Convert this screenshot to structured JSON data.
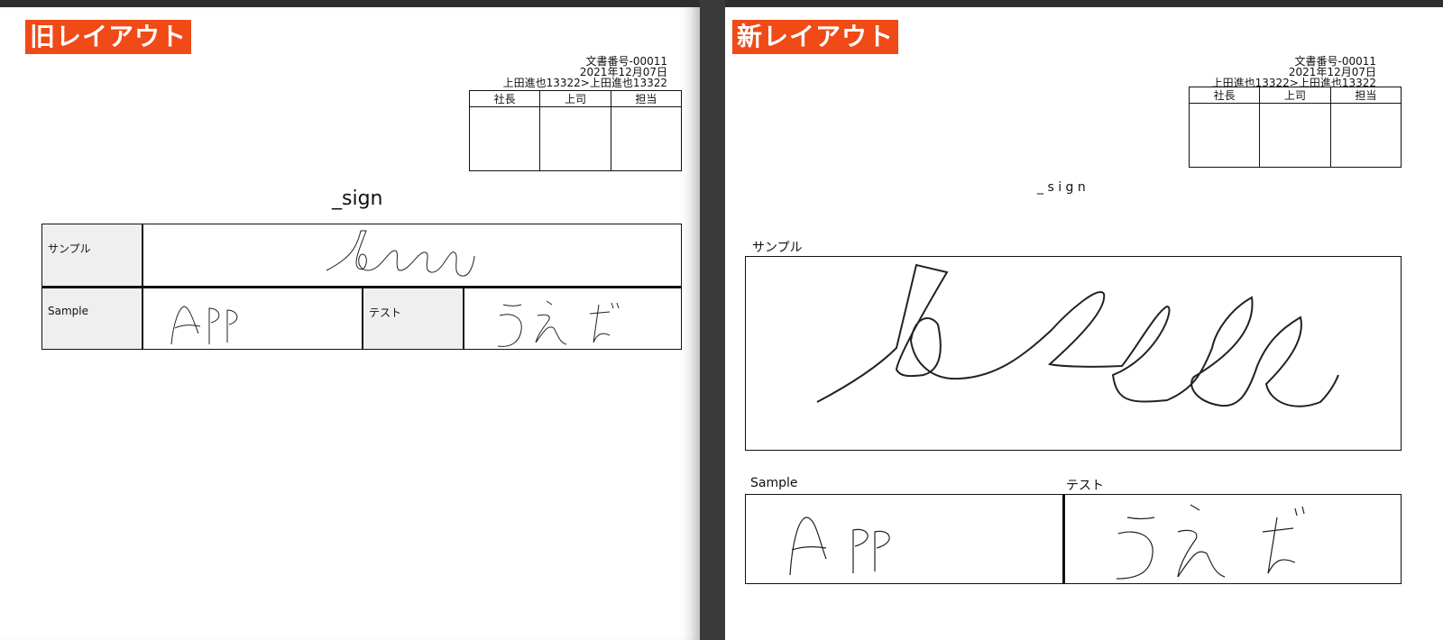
{
  "left": {
    "tag": "旧レイアウト",
    "doc_no": "文書番号-00011",
    "date": "2021年12月07日",
    "route": "上田進也13322>上田進也13322",
    "approvals": [
      "社長",
      "上司",
      "担当"
    ],
    "title": "_sign",
    "fields": {
      "sample_jp": "サンプル",
      "sample_en": "Sample",
      "test": "テスト"
    }
  },
  "right": {
    "tag": "新レイアウト",
    "doc_no": "文書番号-00011",
    "date": "2021年12月07日",
    "route": "上田進也13322>上田進也13322",
    "approvals": [
      "社長",
      "上司",
      "担当"
    ],
    "title": "_ s i g n",
    "fields": {
      "sample_jp": "サンプル",
      "sample_en": "Sample",
      "test": "テスト"
    }
  },
  "signature_icons": [
    "signature-leelle",
    "signature-app",
    "signature-une"
  ]
}
